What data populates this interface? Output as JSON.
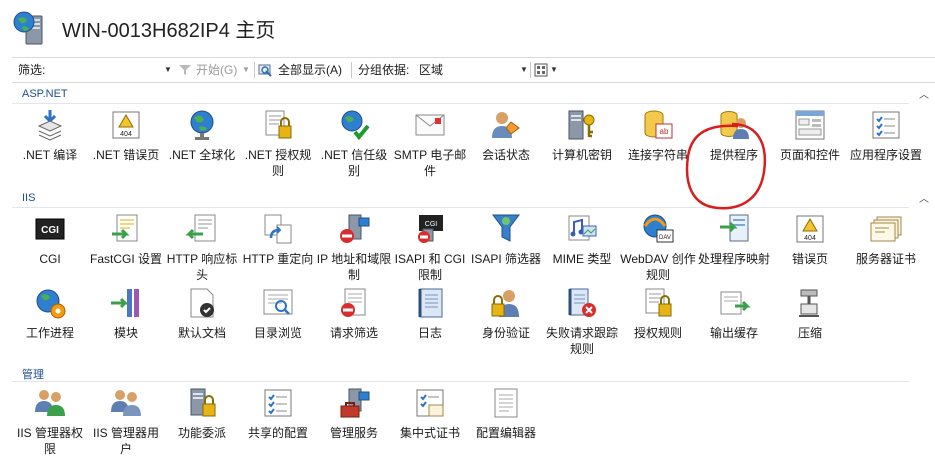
{
  "header": {
    "title": "WIN-0013H682IP4 主页"
  },
  "toolbar": {
    "filter_label": "筛选:",
    "start_label": "开始(G)",
    "show_all_label": "全部显示(A)",
    "group_by_label": "分组依据:",
    "group_by_value": "区域"
  },
  "groups": {
    "aspnet": {
      "label": "ASP.NET",
      "items": [
        {
          "label": ".NET 编译",
          "icon": "compile-icon"
        },
        {
          "label": ".NET 错误页",
          "icon": "error-page-icon"
        },
        {
          "label": ".NET 全球化",
          "icon": "globe-icon"
        },
        {
          "label": ".NET 授权规则",
          "icon": "lock-doc-icon"
        },
        {
          "label": ".NET 信任级别",
          "icon": "trust-icon"
        },
        {
          "label": "SMTP 电子邮件",
          "icon": "mail-icon"
        },
        {
          "label": "会话状态",
          "icon": "session-icon"
        },
        {
          "label": "计算机密钥",
          "icon": "machine-key-icon"
        },
        {
          "label": "连接字符串",
          "icon": "connection-string-icon"
        },
        {
          "label": "提供程序",
          "icon": "provider-icon"
        },
        {
          "label": "页面和控件",
          "icon": "pages-controls-icon"
        },
        {
          "label": "应用程序设置",
          "icon": "app-settings-icon"
        }
      ]
    },
    "iis": {
      "label": "IIS",
      "items": [
        {
          "label": "CGI",
          "icon": "cgi-icon"
        },
        {
          "label": "FastCGI 设置",
          "icon": "fastcgi-icon"
        },
        {
          "label": "HTTP 响应标头",
          "icon": "http-headers-icon"
        },
        {
          "label": "HTTP 重定向",
          "icon": "redirect-icon"
        },
        {
          "label": "IP 地址和域限制",
          "icon": "ip-restrict-icon"
        },
        {
          "label": "ISAPI 和 CGI 限制",
          "icon": "isapi-cgi-icon"
        },
        {
          "label": "ISAPI 筛选器",
          "icon": "isapi-filter-icon"
        },
        {
          "label": "MIME 类型",
          "icon": "mime-icon"
        },
        {
          "label": "WebDAV 创作规则",
          "icon": "webdav-icon"
        },
        {
          "label": "处理程序映射",
          "icon": "handler-mapping-icon"
        },
        {
          "label": "错误页",
          "icon": "error-page-icon"
        },
        {
          "label": "服务器证书",
          "icon": "certificate-icon"
        },
        {
          "label": "工作进程",
          "icon": "worker-process-icon"
        },
        {
          "label": "模块",
          "icon": "modules-icon"
        },
        {
          "label": "默认文档",
          "icon": "default-doc-icon"
        },
        {
          "label": "目录浏览",
          "icon": "dir-browse-icon"
        },
        {
          "label": "请求筛选",
          "icon": "request-filter-icon"
        },
        {
          "label": "日志",
          "icon": "logging-icon"
        },
        {
          "label": "身份验证",
          "icon": "authentication-icon"
        },
        {
          "label": "失败请求跟踪规则",
          "icon": "failed-request-icon"
        },
        {
          "label": "授权规则",
          "icon": "authorization-icon"
        },
        {
          "label": "输出缓存",
          "icon": "output-cache-icon"
        },
        {
          "label": "压缩",
          "icon": "compression-icon"
        }
      ]
    },
    "management": {
      "label": "管理",
      "items": [
        {
          "label": "IIS 管理器权限",
          "icon": "manager-permissions-icon"
        },
        {
          "label": "IIS 管理器用户",
          "icon": "manager-users-icon"
        },
        {
          "label": "功能委派",
          "icon": "feature-delegation-icon"
        },
        {
          "label": "共享的配置",
          "icon": "shared-config-icon"
        },
        {
          "label": "管理服务",
          "icon": "management-service-icon"
        },
        {
          "label": "集中式证书",
          "icon": "central-cert-icon"
        },
        {
          "label": "配置编辑器",
          "icon": "config-editor-icon"
        }
      ]
    }
  },
  "colors": {
    "accent": "#1e4e8c",
    "highlight": "#d81e1e"
  }
}
